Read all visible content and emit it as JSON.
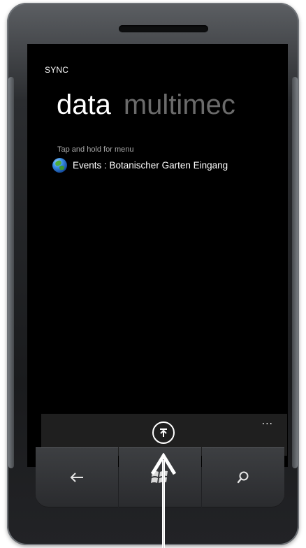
{
  "app": {
    "title": "SYNC"
  },
  "pivot": {
    "active": "data",
    "next": "multimec"
  },
  "list": {
    "hint": "Tap and hold for menu",
    "items": [
      {
        "icon": "globe-icon",
        "text": "Events :  Botanischer Garten Eingang"
      }
    ]
  },
  "appbar": {
    "more": "...",
    "buttons": [
      {
        "icon": "upload-icon"
      }
    ]
  },
  "hardware_buttons": [
    {
      "icon": "back-arrow-icon"
    },
    {
      "icon": "windows-logo-icon"
    },
    {
      "icon": "search-icon"
    }
  ],
  "colors": {
    "screen": "#000000",
    "text": "#ffffff",
    "pivot_inactive": "#6b6b6b",
    "appbar": "#1f1f1f"
  }
}
